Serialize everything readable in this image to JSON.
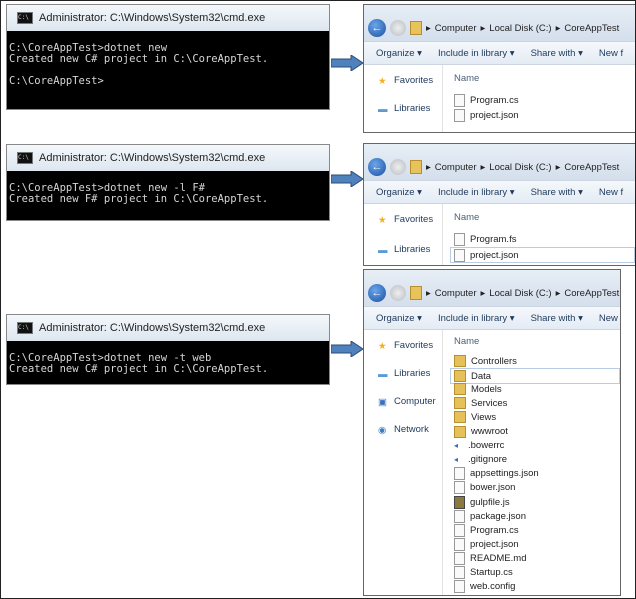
{
  "panels": [
    {
      "cmd": {
        "title": "Administrator: C:\\Windows\\System32\\cmd.exe",
        "lines": [
          "C:\\CoreAppTest>dotnet new",
          "Created new C# project in C:\\CoreAppTest.",
          "",
          "C:\\CoreAppTest>"
        ]
      },
      "explorer": {
        "breadcrumb": [
          "Computer",
          "Local Disk (C:)",
          "CoreAppTest"
        ],
        "toolbar": [
          "Organize ▾",
          "Include in library ▾",
          "Share with ▾",
          "New f"
        ],
        "nav": [
          "Favorites",
          "Libraries"
        ],
        "header": "Name",
        "files": [
          {
            "name": "Program.cs",
            "icon": "file"
          },
          {
            "name": "project.json",
            "icon": "json"
          }
        ]
      }
    },
    {
      "cmd": {
        "title": "Administrator: C:\\Windows\\System32\\cmd.exe",
        "lines": [
          "C:\\CoreAppTest>dotnet new -l F#",
          "Created new F# project in C:\\CoreAppTest."
        ]
      },
      "explorer": {
        "breadcrumb": [
          "Computer",
          "Local Disk (C:)",
          "CoreAppTest"
        ],
        "toolbar": [
          "Organize ▾",
          "Include in library ▾",
          "Share with ▾",
          "New f"
        ],
        "nav": [
          "Favorites",
          "Libraries"
        ],
        "header": "Name",
        "files": [
          {
            "name": "Program.fs",
            "icon": "fs"
          },
          {
            "name": "project.json",
            "icon": "json"
          }
        ]
      }
    },
    {
      "cmd": {
        "title": "Administrator: C:\\Windows\\System32\\cmd.exe",
        "lines": [
          "C:\\CoreAppTest>dotnet new -t web",
          "Created new C# project in C:\\CoreAppTest."
        ]
      },
      "explorer": {
        "breadcrumb": [
          "Computer",
          "Local Disk (C:)",
          "CoreAppTest"
        ],
        "toolbar": [
          "Organize ▾",
          "Include in library ▾",
          "Share with ▾",
          "New fo"
        ],
        "nav": [
          "Favorites",
          "Libraries",
          "Computer",
          "Network"
        ],
        "header": "Name",
        "files": [
          {
            "name": "Controllers",
            "icon": "folder"
          },
          {
            "name": "Data",
            "icon": "folder"
          },
          {
            "name": "Models",
            "icon": "folder"
          },
          {
            "name": "Services",
            "icon": "folder"
          },
          {
            "name": "Views",
            "icon": "folder"
          },
          {
            "name": "wwwroot",
            "icon": "folder"
          },
          {
            "name": ".bowerrc",
            "icon": "dot"
          },
          {
            "name": ".gitignore",
            "icon": "dot"
          },
          {
            "name": "appsettings.json",
            "icon": "json"
          },
          {
            "name": "bower.json",
            "icon": "json"
          },
          {
            "name": "gulpfile.js",
            "icon": "gulp"
          },
          {
            "name": "package.json",
            "icon": "json"
          },
          {
            "name": "Program.cs",
            "icon": "file"
          },
          {
            "name": "project.json",
            "icon": "json"
          },
          {
            "name": "README.md",
            "icon": "json"
          },
          {
            "name": "Startup.cs",
            "icon": "file"
          },
          {
            "name": "web.config",
            "icon": "json"
          }
        ]
      }
    }
  ],
  "colors": {
    "arrow": "#4f81bd",
    "cmd_bg": "#000000",
    "cmd_text": "#d6d6d6"
  }
}
